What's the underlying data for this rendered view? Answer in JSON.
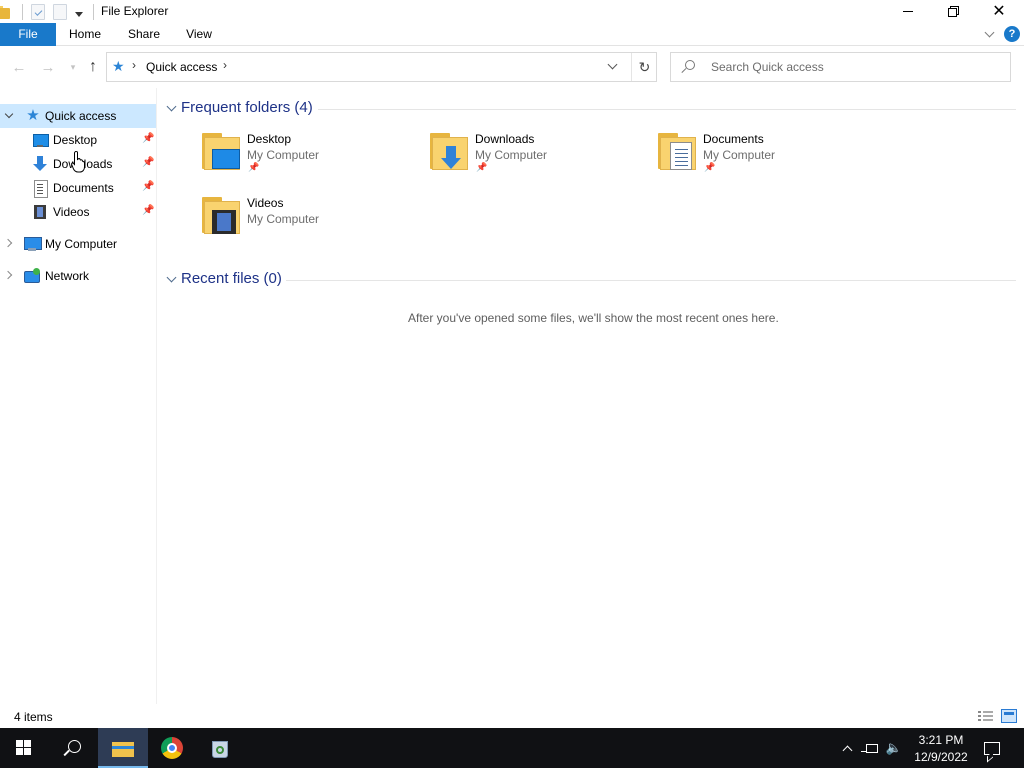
{
  "window": {
    "title": "File Explorer"
  },
  "ribbon": {
    "tabs": [
      "File",
      "Home",
      "Share",
      "View"
    ]
  },
  "address": {
    "path": "Quick access",
    "search_placeholder": "Search Quick access"
  },
  "nav": {
    "quick_access": "Quick access",
    "quick_items": [
      "Desktop",
      "Downloads",
      "Documents",
      "Videos"
    ],
    "my_computer": "My Computer",
    "network": "Network"
  },
  "content": {
    "frequent_heading": "Frequent folders (4)",
    "folders": [
      {
        "name": "Desktop",
        "location": "My Computer",
        "pinned": true
      },
      {
        "name": "Downloads",
        "location": "My Computer",
        "pinned": true
      },
      {
        "name": "Documents",
        "location": "My Computer",
        "pinned": true
      },
      {
        "name": "Videos",
        "location": "My Computer",
        "pinned": false
      }
    ],
    "recent_heading": "Recent files (0)",
    "recent_empty": "After you've opened some files, we'll show the most recent ones here."
  },
  "status": {
    "item_count": "4 items"
  },
  "taskbar": {
    "time": "3:21 PM",
    "date": "12/9/2022"
  },
  "colors": {
    "accent": "#1979ca",
    "selection": "#cce8ff",
    "taskbar": "#101114",
    "heading": "#1e3287"
  }
}
